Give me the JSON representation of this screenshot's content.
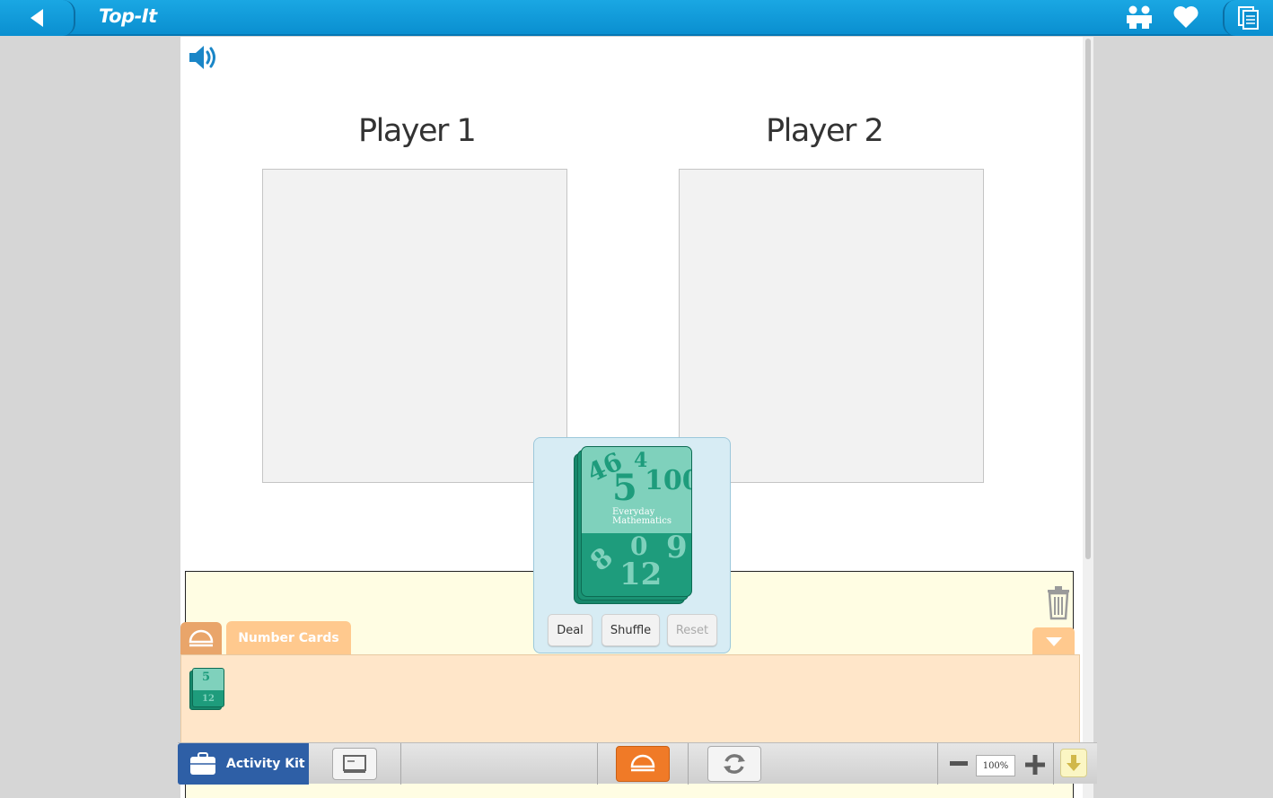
{
  "app": {
    "title": "Top-It"
  },
  "header": {
    "icons": [
      "back-arrow-icon",
      "two-people-icon",
      "heart-icon",
      "pages-icon"
    ]
  },
  "players": [
    {
      "label": "Player 1"
    },
    {
      "label": "Player 2"
    }
  ],
  "deck": {
    "card_texts": {
      "top_numbers": [
        "46",
        "4",
        "5",
        "100"
      ],
      "brand": "Everyday Mathematics",
      "bottom_numbers": [
        "8",
        "0",
        "9",
        "12"
      ]
    },
    "buttons": {
      "deal": "Deal",
      "shuffle": "Shuffle",
      "reset": "Reset"
    },
    "reset_disabled": true
  },
  "drawer": {
    "tab_label": "Number Cards"
  },
  "toolbar": {
    "activity_kit_label": "Activity Kit",
    "zoom_value": "100%"
  },
  "colors": {
    "header_blue": "#0a8fd0",
    "toolbar_orange": "#f07a27",
    "drawer_peach": "#ffe6c9",
    "tab_orange": "#ffc98e",
    "card_green": "#1e9c7c",
    "activity_kit_blue": "#2e5fa6"
  }
}
